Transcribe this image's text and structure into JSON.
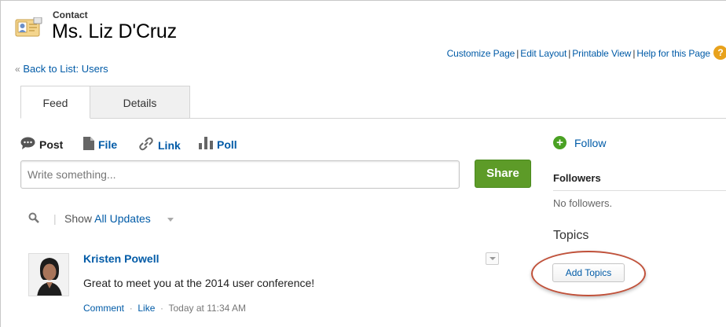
{
  "header": {
    "record_type": "Contact",
    "record_name": "Ms. Liz D'Cruz",
    "icon": "contact-card-icon"
  },
  "page_links": {
    "items": [
      "Customize Page",
      "Edit Layout",
      "Printable View",
      "Help for this Page"
    ],
    "separator": "|",
    "help_icon": "help-icon"
  },
  "back_link": {
    "prefix": "«",
    "label": "Back to List: Users"
  },
  "tabs": [
    {
      "label": "Feed",
      "selected": true
    },
    {
      "label": "Details",
      "selected": false
    }
  ],
  "publisher": {
    "actions": [
      {
        "label": "Post",
        "icon": "chat-bubble-icon",
        "active": true
      },
      {
        "label": "File",
        "icon": "file-icon",
        "active": false
      },
      {
        "label": "Link",
        "icon": "link-icon",
        "active": false
      },
      {
        "label": "Poll",
        "icon": "poll-icon",
        "active": false
      }
    ],
    "placeholder": "Write something...",
    "share_label": "Share"
  },
  "filter": {
    "show_label": "Show",
    "value": "All Updates",
    "search_icon": "search-icon"
  },
  "feed_item": {
    "author": "Kristen Powell",
    "body": "Great to meet you at the 2014 user conference!",
    "actions": [
      "Comment",
      "Like"
    ],
    "separator": "·",
    "timestamp": "Today at 11:34 AM"
  },
  "sidebar": {
    "follow_label": "Follow",
    "followers_heading": "Followers",
    "followers_empty": "No followers.",
    "topics_heading": "Topics",
    "add_topics_label": "Add Topics"
  },
  "colors": {
    "link": "#015ba7",
    "share_button": "#5d9b28",
    "follow_plus": "#4aa123",
    "highlight_ring": "#c0513a",
    "help_icon": "#e8a21c"
  }
}
